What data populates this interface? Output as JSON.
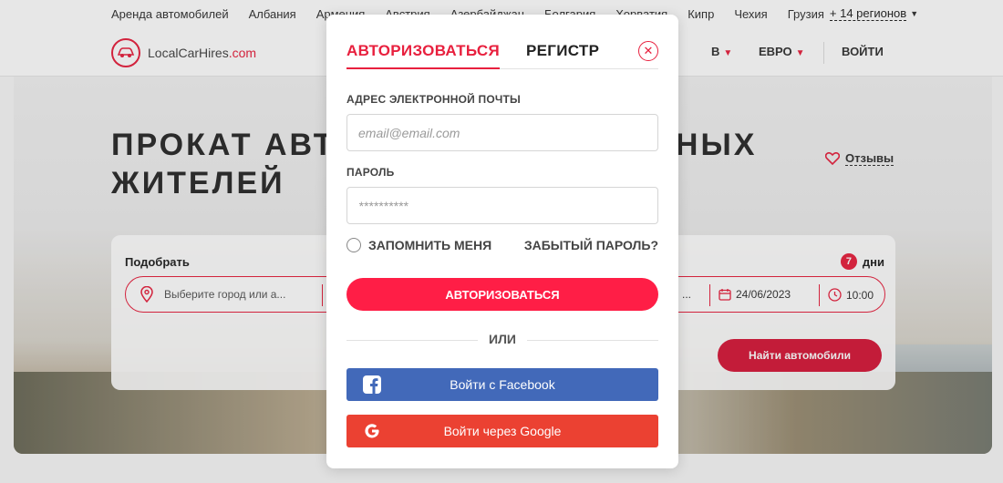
{
  "topbar": {
    "items": [
      "Аренда автомобилей",
      "Албания",
      "Армения",
      "Австрия",
      "Азербайджан",
      "Болгария",
      "Хорватия",
      "Кипр",
      "Чехия",
      "Грузия"
    ],
    "more": "+ 14 регионов"
  },
  "header": {
    "logo_name": "LocalCarHires",
    "logo_domain": ".com",
    "language": "В",
    "currency": "ЕВРО",
    "login": "ВОЙТИ"
  },
  "hero": {
    "title_line1": "ПРОКАТ АВТ                              НЫХ",
    "title_line2": "ЖИТЕЛЕЙ",
    "reviews": "Отзывы"
  },
  "search": {
    "pickup_label": "Подобрать",
    "days_count": "7",
    "days_label": "дни",
    "city_placeholder": "Выберите город или а...",
    "date_partial": "...",
    "date": "24/06/2023",
    "time": "10:00",
    "find_button": "Найти автомобили"
  },
  "modal": {
    "tab_login": "АВТОРИЗОВАТЬСЯ",
    "tab_register": "РЕГИСТР",
    "email_label": "АДРЕС ЭЛЕКТРОННОЙ ПОЧТЫ",
    "email_placeholder": "email@email.com",
    "password_label": "ПАРОЛЬ",
    "password_placeholder": "**********",
    "remember_me": "ЗАПОМНИТЬ МЕНЯ",
    "forgot_password": "ЗАБЫТЫЙ ПАРОЛЬ?",
    "login_button": "АВТОРИЗОВАТЬСЯ",
    "or": "ИЛИ",
    "facebook_button": "Войти с Facebook",
    "google_button": "Войти через Google"
  },
  "colors": {
    "accent": "#e8203e",
    "facebook": "#4269b9",
    "google": "#eb4132"
  },
  "icons": [
    "logo-car-icon",
    "chevron-down-icon",
    "heart-icon",
    "location-pin-icon",
    "calendar-icon",
    "clock-icon",
    "close-icon",
    "facebook-icon",
    "google-icon"
  ]
}
